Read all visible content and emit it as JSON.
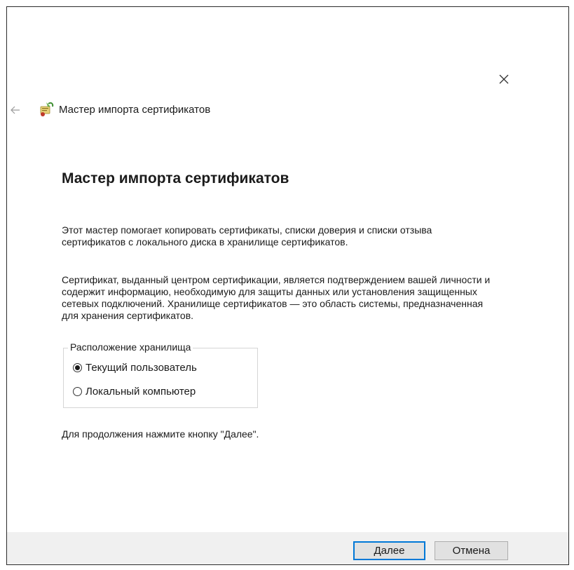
{
  "window": {
    "title": "Мастер импорта сертификатов"
  },
  "icons": {
    "close": "close-icon",
    "back": "back-arrow-icon",
    "wizard": "certificate-wizard-icon"
  },
  "page": {
    "heading": "Мастер импорта сертификатов",
    "paragraph1": "Этот мастер помогает копировать сертификаты, списки доверия и списки отзыва сертификатов с локального диска в хранилище сертификатов.",
    "paragraph2": "Сертификат, выданный центром сертификации, является подтверждением вашей личности и содержит информацию, необходимую для защиты данных или установления защищенных сетевых подключений. Хранилище сертификатов — это область системы, предназначенная для хранения сертификатов.",
    "store_location": {
      "legend": "Расположение хранилища",
      "options": [
        {
          "label": "Текущий пользователь",
          "selected": true
        },
        {
          "label": "Локальный компьютер",
          "selected": false
        }
      ]
    },
    "hint": "Для продолжения нажмите кнопку \"Далее\"."
  },
  "footer": {
    "next_label": "Далее",
    "cancel_label": "Отмена"
  },
  "colors": {
    "accent": "#0078d7",
    "footer_bg": "#f0f0f0"
  }
}
